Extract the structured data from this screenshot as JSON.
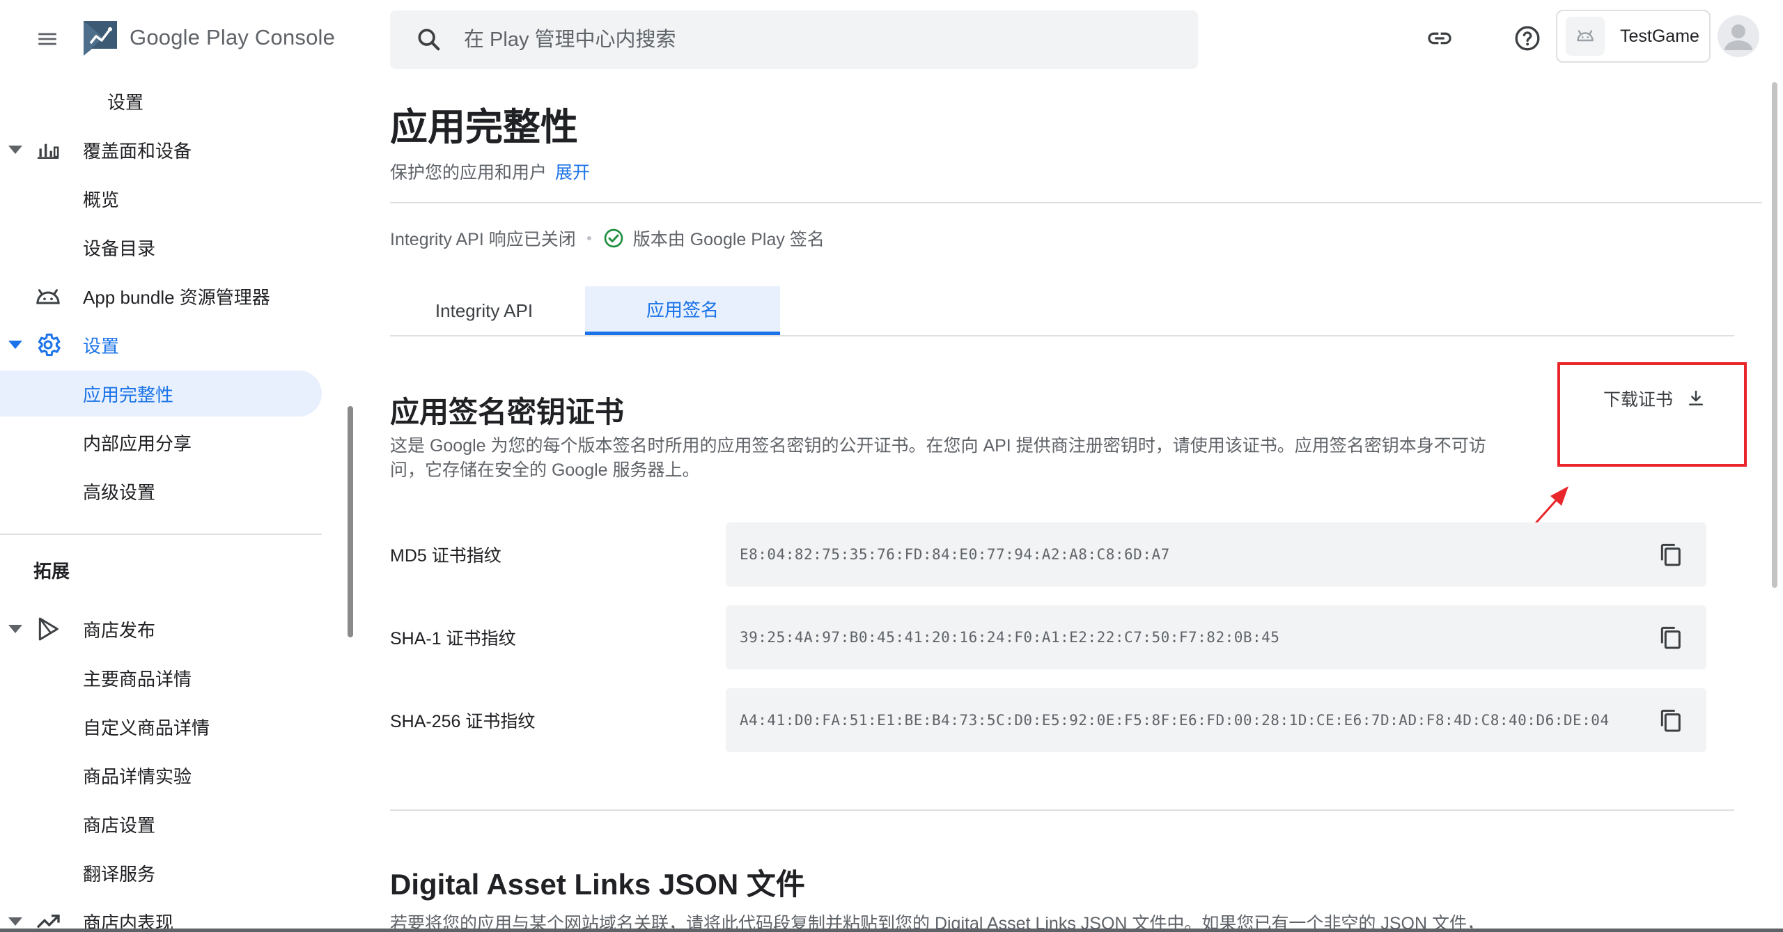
{
  "header": {
    "logo_text_google": "Google Play",
    "logo_text_console": "Console",
    "search_placeholder": "在 Play 管理中心内搜索",
    "app_name": "TestGame"
  },
  "sidebar": {
    "items": [
      {
        "label": "设置"
      },
      {
        "label": "覆盖面和设备"
      },
      {
        "label": "概览"
      },
      {
        "label": "设备目录"
      },
      {
        "label": "App bundle 资源管理器"
      },
      {
        "label": "设置"
      },
      {
        "label": "应用完整性"
      },
      {
        "label": "内部应用分享"
      },
      {
        "label": "高级设置"
      }
    ],
    "section_title": "拓展",
    "items2": [
      {
        "label": "商店发布"
      },
      {
        "label": "主要商品详情"
      },
      {
        "label": "自定义商品详情"
      },
      {
        "label": "商品详情实验"
      },
      {
        "label": "商店设置"
      },
      {
        "label": "翻译服务"
      },
      {
        "label": "商店内表现"
      }
    ]
  },
  "page": {
    "title": "应用完整性",
    "subtitle": "保护您的应用和用户",
    "expand_link": "展开",
    "status_api": "Integrity API 响应已关闭",
    "status_signing": "版本由 Google Play 签名",
    "tabs": [
      {
        "label": "Integrity API"
      },
      {
        "label": "应用签名"
      }
    ]
  },
  "cert": {
    "title": "应用签名密钥证书",
    "description": "这是 Google 为您的每个版本签名时所用的应用签名密钥的公开证书。在您向 API 提供商注册密钥时，请使用该证书。应用签名密钥本身不可访问，它存储在安全的 Google 服务器上。",
    "download_label": "下载证书",
    "fingerprints": [
      {
        "label": "MD5 证书指纹",
        "value": "E8:04:82:75:35:76:FD:84:E0:77:94:A2:A8:C8:6D:A7"
      },
      {
        "label": "SHA-1 证书指纹",
        "value": "39:25:4A:97:B0:45:41:20:16:24:F0:A1:E2:22:C7:50:F7:82:0B:45"
      },
      {
        "label": "SHA-256 证书指纹",
        "value": "A4:41:D0:FA:51:E1:BE:B4:73:5C:D0:E5:92:0E:F5:8F:E6:FD:00:28:1D:CE:E6:7D:AD:F8:4D:C8:40:D6:DE:04"
      }
    ]
  },
  "dal": {
    "title": "Digital Asset Links JSON 文件",
    "description": "若要将您的应用与某个网站域名关联，请将此代码段复制并粘贴到您的 Digital Asset Links JSON 文件中。如果您已有一个非空的 JSON 文件，"
  },
  "colors": {
    "accent": "#1a73e8",
    "selected_bg": "#e8f0fe",
    "annotation_red": "#e8262b",
    "success_green": "#1e8e3e"
  }
}
